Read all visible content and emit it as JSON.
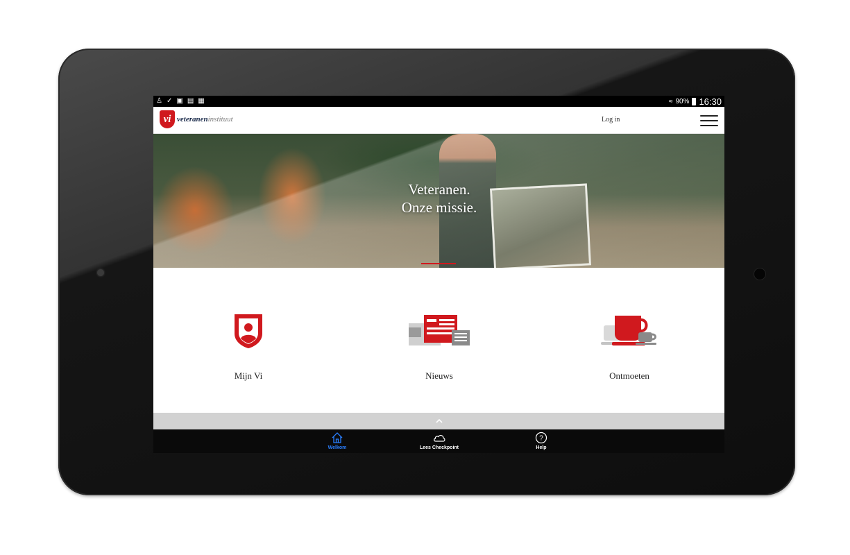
{
  "status_bar": {
    "battery": "90%",
    "time": "16:30"
  },
  "app_bar": {
    "logo_mark": "vi",
    "logo_text_bold": "veteranen",
    "logo_text_light": "instituut",
    "login_label": "Log in"
  },
  "hero": {
    "title_line1": "Veteranen.",
    "title_line2": "Onze missie."
  },
  "tiles": [
    {
      "label": "Mijn Vi",
      "icon": "shield-person-icon"
    },
    {
      "label": "Nieuws",
      "icon": "newspaper-icon"
    },
    {
      "label": "Ontmoeten",
      "icon": "coffee-cup-icon"
    }
  ],
  "collapse_bar": {
    "icon": "chevron-up-icon"
  },
  "tab_bar": {
    "tabs": [
      {
        "label": "Welkom",
        "icon": "home-icon",
        "active": true
      },
      {
        "label": "Lees Checkpoint",
        "icon": "cloud-icon",
        "active": false
      },
      {
        "label": "Help",
        "icon": "help-circle-icon",
        "active": false
      }
    ]
  },
  "colors": {
    "brand_red": "#d0191e",
    "active_tab": "#2a7fff"
  }
}
